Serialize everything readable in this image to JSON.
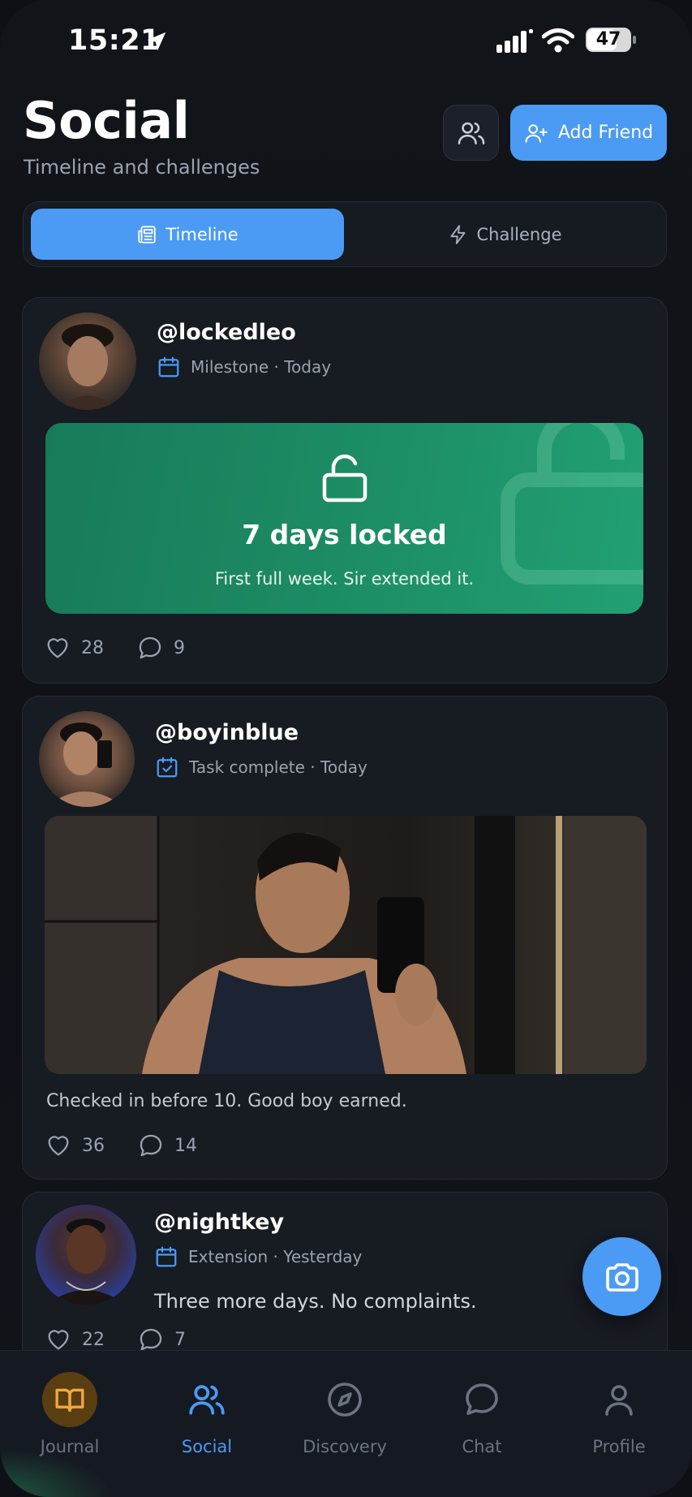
{
  "status_bar": {
    "time": "15:21",
    "battery": "47"
  },
  "header": {
    "title": "Social",
    "subtitle": "Timeline and challenges",
    "add_friend_label": "Add Friend"
  },
  "tabs": [
    {
      "label": "Timeline",
      "icon": "newspaper-icon",
      "active": true
    },
    {
      "label": "Challenge",
      "icon": "lightning-icon",
      "active": false
    }
  ],
  "posts": [
    {
      "username": "@lockedleo",
      "type": "Milestone",
      "time": "Today",
      "milestone_title": "7 days locked",
      "milestone_text": "First full week. Sir extended it.",
      "likes": "28",
      "comments": "9"
    },
    {
      "username": "@boyinblue",
      "type": "Task complete",
      "time": "Today",
      "caption": "Checked in before 10. Good boy earned.",
      "likes": "36",
      "comments": "14"
    },
    {
      "username": "@nightkey",
      "type": "Extension",
      "time": "Yesterday",
      "caption": "Three more days. No complaints.",
      "likes": "22",
      "comments": "7"
    }
  ],
  "nav": [
    {
      "label": "Journal",
      "icon": "book-icon"
    },
    {
      "label": "Social",
      "icon": "users-icon",
      "active": true
    },
    {
      "label": "Discovery",
      "icon": "compass-icon"
    },
    {
      "label": "Chat",
      "icon": "chat-bubble-icon"
    },
    {
      "label": "Profile",
      "icon": "person-icon"
    }
  ],
  "colors": {
    "accent": "#4b9bf5",
    "milestone_green": "#1d8e66",
    "background": "#0f1217",
    "card": "#171b22"
  }
}
